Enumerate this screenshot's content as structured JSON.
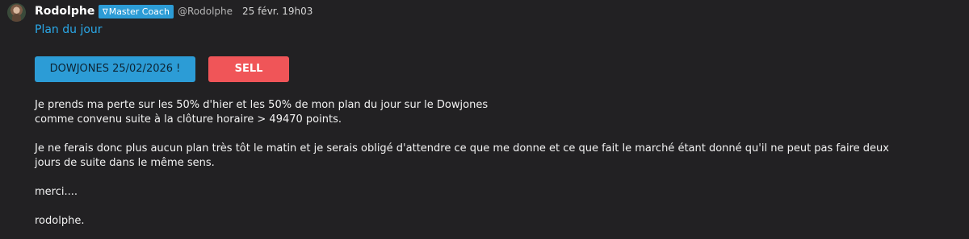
{
  "message": {
    "author": "Rodolphe",
    "badge": {
      "icon": "check-v-icon",
      "glyph": "∇",
      "label": "Master Coach",
      "color": "#2c9cd6"
    },
    "handle": "@Rodolphe",
    "timestamp": "25 févr. 19h03",
    "title": "Plan du jour",
    "buttons": {
      "symbol_label": "DOWJONES 25/02/2026 !",
      "action_label": "SELL"
    },
    "paragraphs": [
      "Je prends ma perte sur les 50% d'hier et les 50% de mon plan du jour sur le Dowjones\ncomme convenu suite à la clôture horaire > 49470 points.",
      "Je ne ferais donc plus aucun plan très tôt le matin et je serais obligé d'attendre ce que me donne et ce que fait le marché étant donné qu'il ne peut pas faire deux\njours de suite dans le même sens.",
      "merci....",
      "rodolphe."
    ]
  },
  "colors": {
    "background": "#222123",
    "accent": "#2aa8e8",
    "sell": "#f05558"
  }
}
